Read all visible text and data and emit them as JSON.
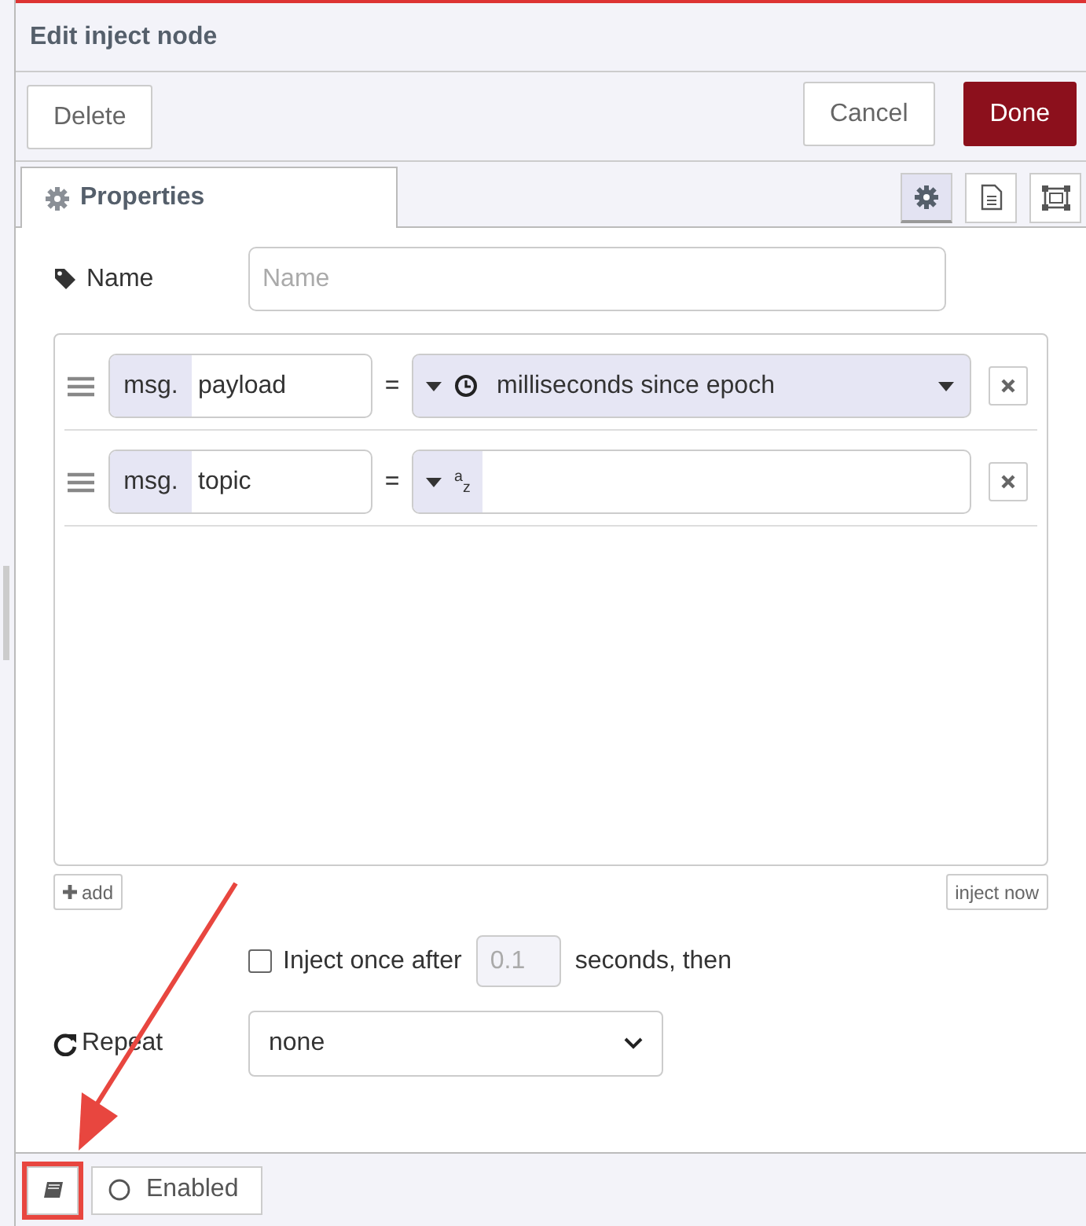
{
  "title": "Edit inject node",
  "buttons": [
    {
      "label": "Delete",
      "kind": "delete"
    },
    {
      "label": "Cancel",
      "kind": "cancel"
    },
    {
      "label": "Done",
      "kind": "primary"
    }
  ],
  "tabs": [
    {
      "label": "Properties",
      "selected": true
    }
  ],
  "tab_icons": [
    {
      "kind": "gear",
      "selected": true
    },
    {
      "kind": "document",
      "selected": false
    },
    {
      "kind": "frame",
      "selected": false
    }
  ],
  "name_field": {
    "label": "Name",
    "placeholder": "Name"
  },
  "properties": [
    {
      "prefix": "msg.",
      "property": "payload",
      "operator": "=",
      "kind": "timestamp",
      "value": "milliseconds since epoch"
    },
    {
      "prefix": "msg.",
      "property": "topic",
      "operator": "=",
      "kind": "string",
      "type_glyph": "$^{a}$$_{z}$"
    }
  ],
  "add_button": "add",
  "inject_now_button": "inject now",
  "inject_once": {
    "checked": false,
    "label": "Inject once after",
    "delay": "0.1",
    "suffix": "seconds, then"
  },
  "repeat": {
    "label": "Repeat",
    "value": "none"
  },
  "footer": {
    "enabled_label": "Enabled"
  }
}
